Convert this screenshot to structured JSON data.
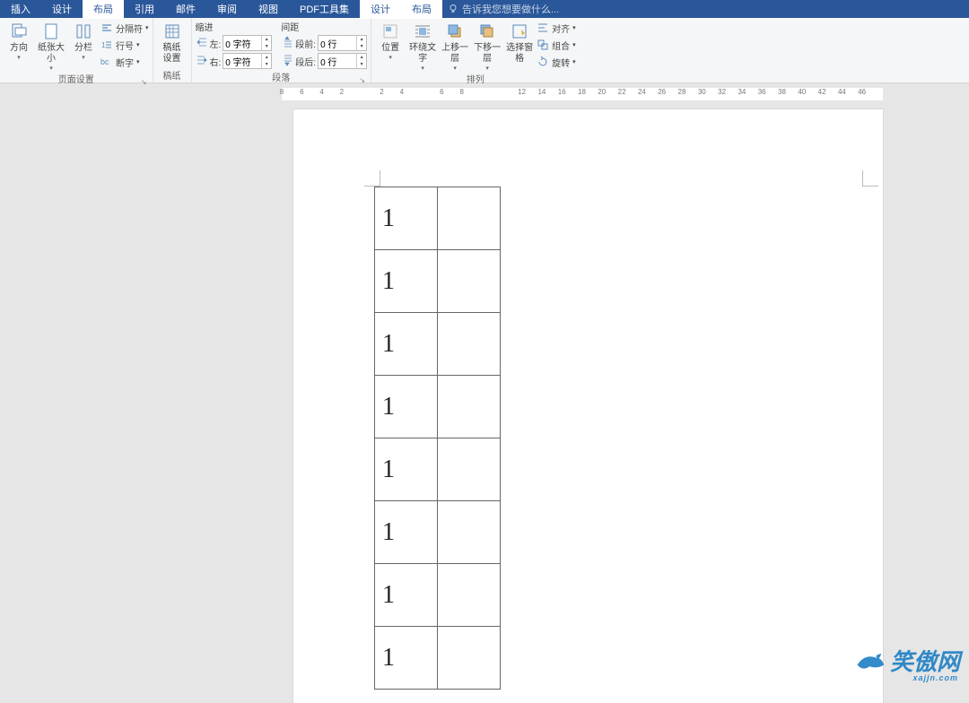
{
  "menu": {
    "tabs": [
      "插入",
      "设计",
      "布局",
      "引用",
      "邮件",
      "审阅",
      "视图",
      "PDF工具集",
      "设计",
      "布局"
    ],
    "active_indices": [
      2,
      8,
      9
    ],
    "tell_me": "告诉我您想要做什么..."
  },
  "ribbon": {
    "page_setup": {
      "orientation": "方向",
      "size": "纸张大小",
      "columns": "分栏",
      "breaks": "分隔符",
      "line_numbers": "行号",
      "hyphenation": "断字",
      "label": "页面设置"
    },
    "manuscript": {
      "btn": "稿纸",
      "btn2": "设置",
      "label": "稿纸"
    },
    "paragraph": {
      "indent_title": "缩进",
      "left_label": "左:",
      "left_value": "0 字符",
      "right_label": "右:",
      "right_value": "0 字符",
      "spacing_title": "间距",
      "before_label": "段前:",
      "before_value": "0 行",
      "after_label": "段后:",
      "after_value": "0 行",
      "label": "段落"
    },
    "arrange": {
      "position": "位置",
      "wrap": "环绕文字",
      "bring_forward": "上移一层",
      "send_backward": "下移一层",
      "selection_pane": "选择窗格",
      "align": "对齐",
      "group": "组合",
      "rotate": "旋转",
      "label": "排列"
    }
  },
  "ruler": {
    "numbers": [
      8,
      6,
      4,
      2,
      "",
      2,
      4,
      "",
      6,
      8,
      "",
      "",
      12,
      14,
      16,
      18,
      20,
      22,
      24,
      26,
      28,
      30,
      32,
      34,
      36,
      38,
      40,
      42,
      44,
      46
    ]
  },
  "document": {
    "table_rows": [
      [
        "1",
        ""
      ],
      [
        "1",
        ""
      ],
      [
        "1",
        ""
      ],
      [
        "1",
        ""
      ],
      [
        "1",
        ""
      ],
      [
        "1",
        ""
      ],
      [
        "1",
        ""
      ],
      [
        "1",
        ""
      ]
    ]
  },
  "watermark": {
    "text": "笑傲网",
    "sub": "xajjn.com"
  }
}
